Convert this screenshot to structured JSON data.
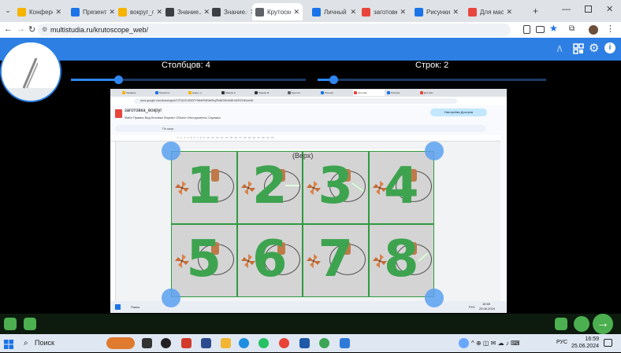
{
  "browser": {
    "tabs": [
      {
        "label": "Конферен",
        "color": "#f6b400"
      },
      {
        "label": "Презентат",
        "color": "#1a73e8"
      },
      {
        "label": "вокруг_пр",
        "color": "#f6b400"
      },
      {
        "label": "Знание.Ак",
        "color": "#3c4043"
      },
      {
        "label": "Знание.Ф",
        "color": "#3c4043"
      },
      {
        "label": "Крутоскоп",
        "color": "#5f6368"
      },
      {
        "label": "Личный",
        "color": "#1a73e8"
      },
      {
        "label": "заготовка",
        "color": "#e8453c"
      },
      {
        "label": "Рисунки",
        "color": "#1a73e8"
      },
      {
        "label": "Для масте",
        "color": "#e8453c"
      }
    ],
    "active_tab_index": 5,
    "url": "multistudia.ru/krutoscope_web/",
    "new_tab_symbol": "+",
    "tab_close_symbol": "✕"
  },
  "stage": {
    "columns_label": "Столбцов: 4",
    "rows_label": "Строк: 2",
    "columns_slider_value": 0.2,
    "rows_slider_value": 0.07
  },
  "inner_screen": {
    "doc_title": "заготовка_вокруг",
    "menu": "Файл  Правка  Вид  Вставка  Формат  Объект  Инструменты  Справка",
    "share_label": "Настройки Доступа",
    "url": "docs.google.com/drawings/d/17FQN7L8DDFYWkbPbB9aRkqPfuBGNhGkBH4KRCNEw/edit",
    "tool_mode": "По шир.",
    "ruler_numbers": "1 . 2 . 3 . 4 . 5 . 6 . 7 . 8 . 9 . 10 . 11 . 12 . 13 . 14 . 15 . 16 . 17 . 18 . 19 . 20 . 21 . 22 . 23 . 24",
    "search_label": "Поиск",
    "clock_time": "16:59",
    "clock_date": "25.06.2024",
    "lang": "РУС",
    "tabs": [
      "Конфере",
      "Презента",
      "вокруг_п",
      "Знание.А",
      "Знание.Ф",
      "Крутоск",
      "Личный",
      "заготовк",
      "Рисунки",
      "Для мас"
    ]
  },
  "slide": {
    "caption": "(Верх)",
    "cells": [
      "1",
      "2",
      "3",
      "4",
      "5",
      "6",
      "7",
      "8"
    ],
    "accent_green": "#3ea34f"
  },
  "taskbar": {
    "search_label": "Поиск",
    "lang": "РУС",
    "time": "16:59",
    "date": "25.06.2024"
  },
  "icons": {
    "appbar": [
      "logo-icon",
      "chevron-up-icon",
      "grid-icon",
      "gear-icon",
      "info-icon"
    ],
    "bottom_left": [
      "image-icon",
      "clipboard-icon"
    ],
    "bottom_right": [
      "grid-icon",
      "refresh-icon",
      "arrow-right-icon"
    ]
  }
}
